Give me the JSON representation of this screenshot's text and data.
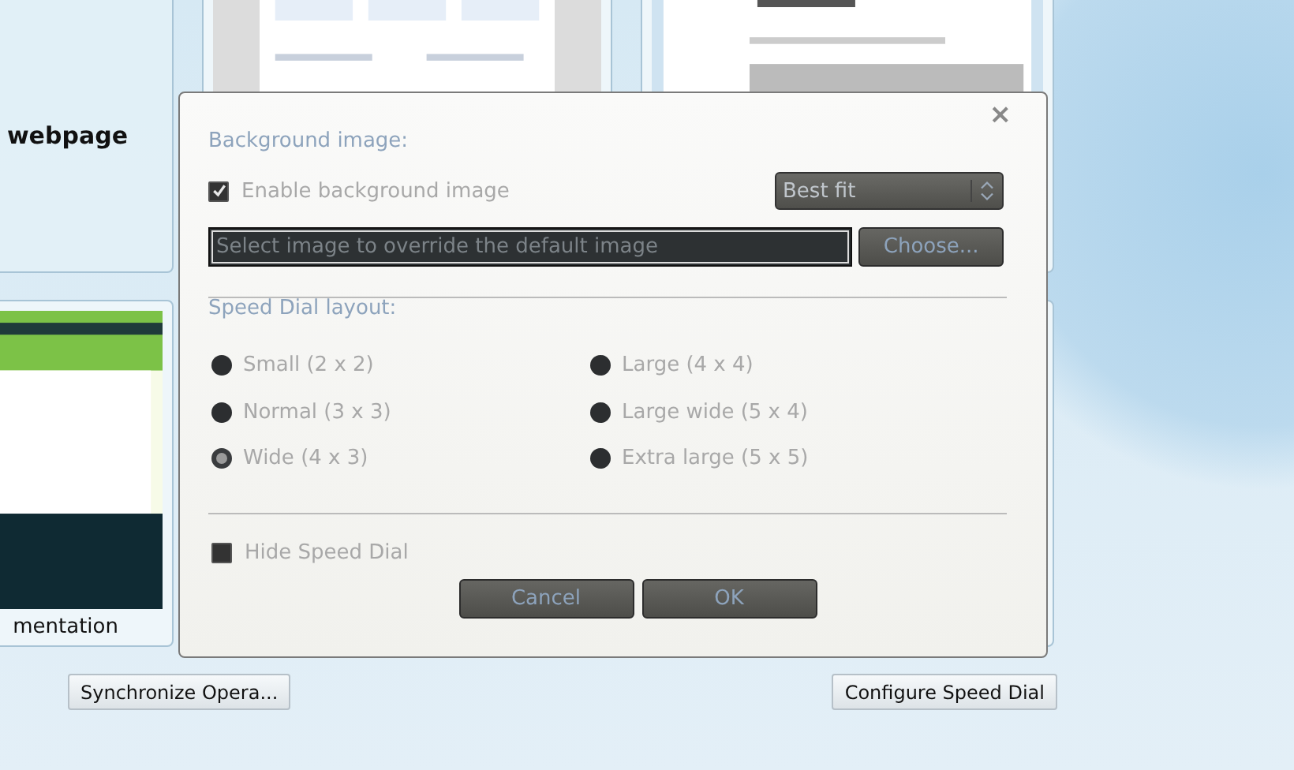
{
  "speed_dial": {
    "tiles": [
      {
        "kind": "title",
        "label": "webpage"
      },
      {
        "kind": "picture"
      },
      {
        "kind": "picture"
      },
      {
        "kind": "picture",
        "label": "mentation"
      },
      {
        "kind": "blank"
      }
    ],
    "buttons": [
      "Synchronize Opera...",
      "Configure Speed Dial"
    ]
  },
  "dialog": {
    "close": "×",
    "background_section": {
      "heading": "Background image:",
      "enable": {
        "label": "Enable background image",
        "checked": true
      },
      "fit": {
        "value": "Best fit"
      },
      "file": {
        "placeholder": "Select image to override the default image"
      },
      "choose": "Choose..."
    },
    "layout_section": {
      "heading": "Speed Dial layout:",
      "options": [
        {
          "label": "Small (2 x 2)",
          "selected": false
        },
        {
          "label": "Normal (3 x 3)",
          "selected": false
        },
        {
          "label": "Wide (4 x 3)",
          "selected": true
        },
        {
          "label": "Large (4 x 4)",
          "selected": false
        },
        {
          "label": "Large wide (5 x 4)",
          "selected": false
        },
        {
          "label": "Extra large (5 x 5)",
          "selected": false
        }
      ]
    },
    "hide": {
      "label": "Hide Speed Dial",
      "checked": false
    },
    "buttons": [
      "Cancel",
      "OK"
    ]
  }
}
